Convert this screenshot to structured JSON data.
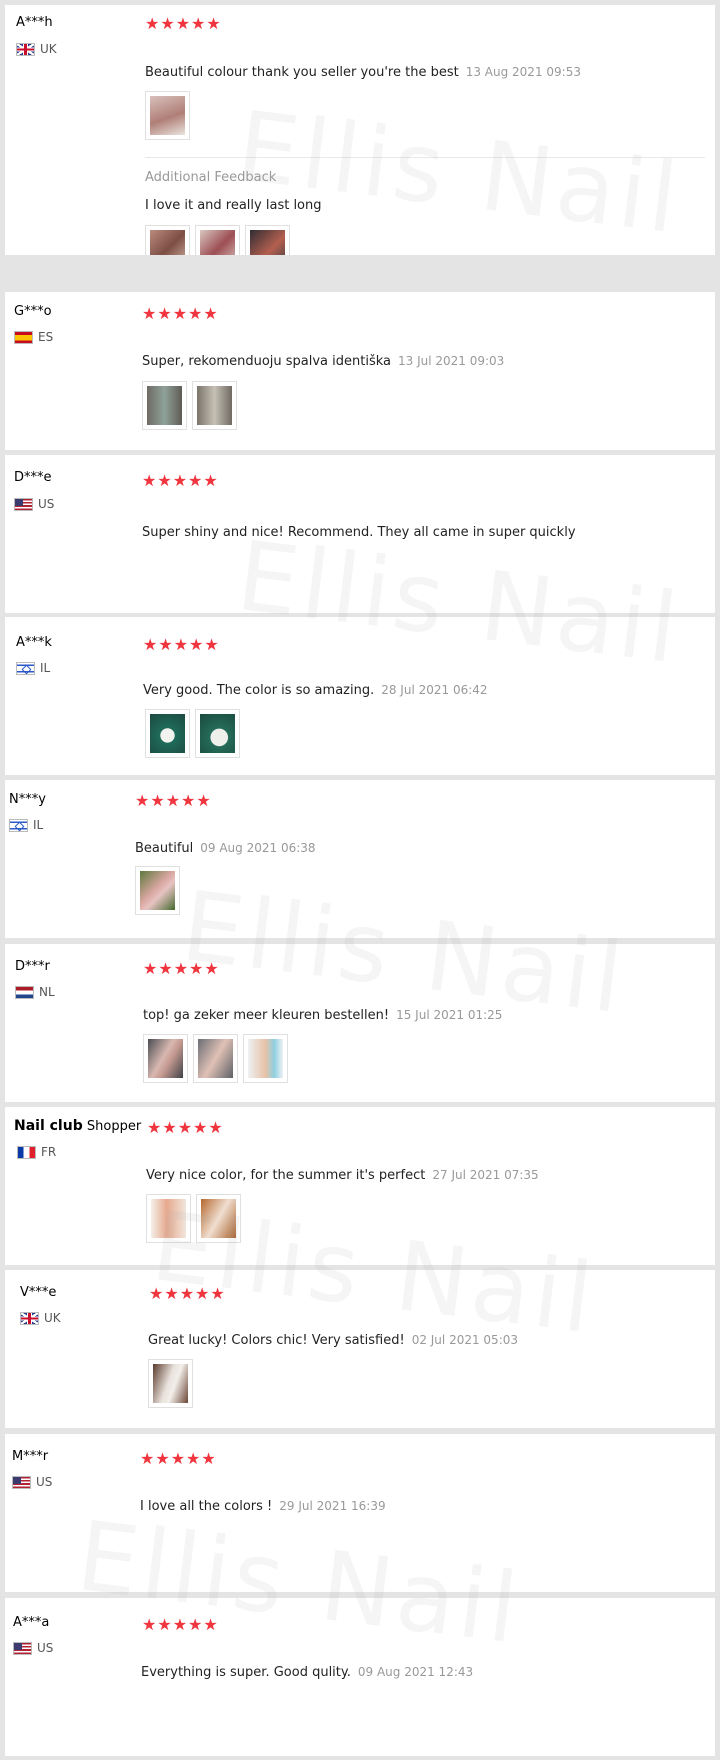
{
  "watermark": "Ellis Nail",
  "stars_display": "★★★★★",
  "reviews": [
    {
      "name": "A***h",
      "country": "UK",
      "rating": 5,
      "text": "Beautiful colour thank you seller you're the best",
      "date": "13 Aug 2021 09:53",
      "additional_label": "Additional Feedback",
      "additional_text": "I love it and really last long"
    },
    {
      "name": "G***o",
      "country": "ES",
      "rating": 5,
      "text": "Super, rekomenduoju spalva identiška",
      "date": "13 Jul 2021 09:03"
    },
    {
      "name": "D***e",
      "country": "US",
      "rating": 5,
      "text": "Super shiny and nice! Recommend. They all came in super quickly"
    },
    {
      "name": "A***k",
      "country": "IL",
      "rating": 5,
      "text": "Very good. The color is so amazing.",
      "date": "28 Jul 2021 06:42"
    },
    {
      "name": "N***y",
      "country": "IL",
      "rating": 5,
      "text": "Beautiful",
      "date": "09 Aug 2021 06:38"
    },
    {
      "name": "D***r",
      "country": "NL",
      "rating": 5,
      "text": "top! ga zeker meer kleuren bestellen!",
      "date": "15 Jul 2021 01:25"
    },
    {
      "name_main": "Nail club",
      "name_suffix": "Shopper",
      "country": "FR",
      "rating": 5,
      "text": "Very nice color, for the summer it's perfect",
      "date": "27 Jul 2021 07:35"
    },
    {
      "name": "V***e",
      "country": "UK",
      "rating": 5,
      "text": "Great lucky! Colors chic! Very satisfied!",
      "date": "02 Jul 2021 05:03"
    },
    {
      "name": "M***r",
      "country": "US",
      "rating": 5,
      "text": "I love all the colors !",
      "date": "29 Jul 2021 16:39"
    },
    {
      "name": "A***a",
      "country": "US",
      "rating": 5,
      "text": "Everything is super. Good qulity.",
      "date": "09 Aug 2021 12:43"
    }
  ]
}
